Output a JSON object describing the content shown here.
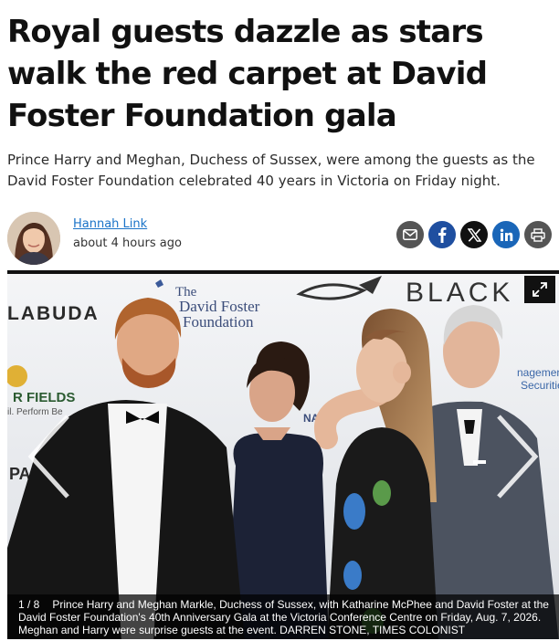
{
  "article": {
    "headline": "Royal guests dazzle as stars walk the red carpet at David Foster Foundation gala",
    "deck": "Prince Harry and Meghan, Duchess of Sussex, were among the guests as the David Foster Foundation celebrated 40 years in Victoria on Friday night."
  },
  "byline": {
    "author": "Hannah Link",
    "timestamp": "about 4 hours ago",
    "avatar_icon": "author-photo"
  },
  "share": [
    {
      "name": "email",
      "icon": "mail-icon",
      "color": "#555555"
    },
    {
      "name": "facebook",
      "icon": "facebook-icon",
      "color": "#1f4fa0"
    },
    {
      "name": "x",
      "icon": "x-icon",
      "color": "#111111"
    },
    {
      "name": "linkedin",
      "icon": "linkedin-icon",
      "color": "#1a66b8"
    },
    {
      "name": "print",
      "icon": "printer-icon",
      "color": "#555555"
    }
  ],
  "gallery": {
    "counter": "1 / 8",
    "caption": "Prince Harry and Meghan Markle, Duchess of Sussex, with Katharine McPhee and David Foster at the David Foster Foundation's 40th Anniversary Gala at the Victoria Conference Centre on Friday, Aug. 7, 2026. Meghan and Harry were surprise guests at the event. DARREN STONE, TIMES COLONIST",
    "backdrop": {
      "labuda": "LABUDA",
      "foundation_the": "The",
      "foundation_line1": "David Foster",
      "foundation_line2": "Foundation",
      "black": "BLACK",
      "fields": "R FIELDS",
      "fields_sub": "il. Perform Be",
      "management": "nagement",
      "securities": "Securities",
      "pa": "PA",
      "ani": "NANI"
    }
  }
}
